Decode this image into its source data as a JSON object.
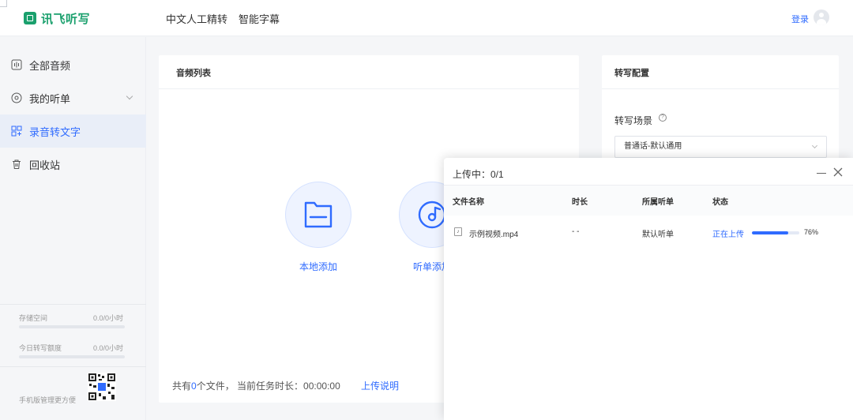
{
  "header": {
    "logo_text": "讯飞听写",
    "nav": [
      "中文人工精转",
      "智能字幕"
    ],
    "login": "登录"
  },
  "sidebar": {
    "items": [
      {
        "label": "全部音频",
        "icon": "waveform-icon"
      },
      {
        "label": "我的听单",
        "icon": "disc-icon"
      },
      {
        "label": "录音转文字",
        "icon": "transcribe-icon",
        "active": true
      },
      {
        "label": "回收站",
        "icon": "trash-icon"
      }
    ],
    "storage_label": "存储空间",
    "storage_value": "0.0/0小时",
    "quota_label": "今日转写额度",
    "quota_value": "0.0/0小时",
    "mobile_text": "手机版管理更方便"
  },
  "main": {
    "title": "音频列表",
    "local_add": "本地添加",
    "list_add": "听单添加",
    "footer_prefix": "共有",
    "file_count": "0",
    "footer_mid": "个文件，  当前任务时长：",
    "duration": "00:00:00",
    "upload_help": "上传说明"
  },
  "config": {
    "title": "转写配置",
    "scene_label": "转写场景",
    "help_glyph": "?",
    "scene_value": "普通话-默认通用"
  },
  "upload_dialog": {
    "title": "上传中：0/1",
    "columns": [
      "文件名称",
      "时长",
      "所属听单",
      "状态"
    ],
    "rows": [
      {
        "file": "示例视频.mp4",
        "duration": "- -",
        "list": "默认听单",
        "status": "正在上传",
        "progress": 0.76,
        "percent": "76%"
      }
    ]
  },
  "colors": {
    "accent": "#2f6bff",
    "brand": "#1aa06d"
  }
}
